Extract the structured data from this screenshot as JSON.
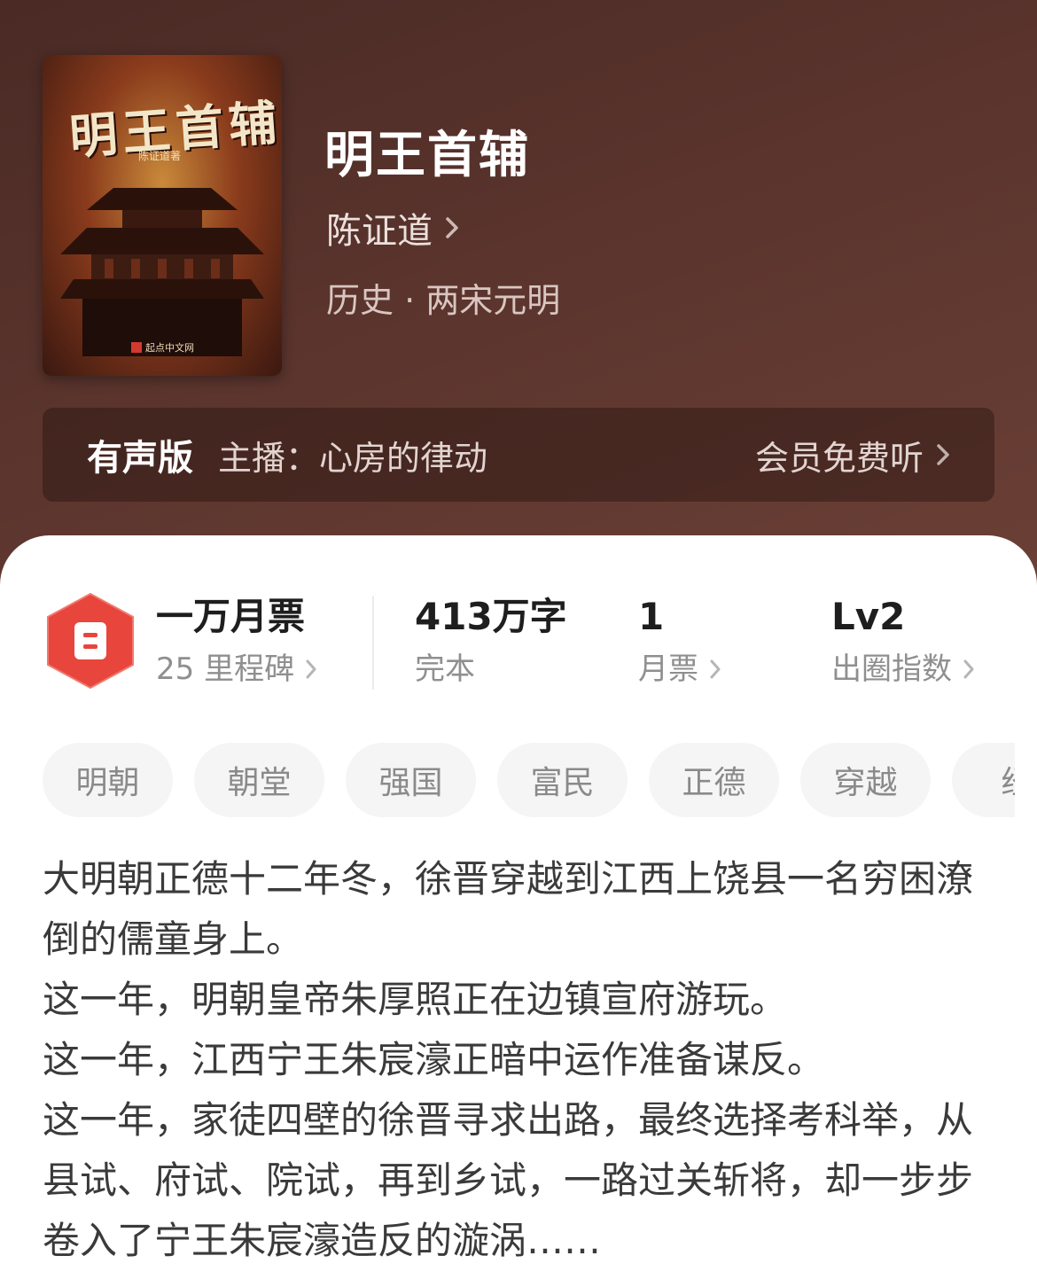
{
  "book": {
    "title": "明王首辅",
    "author": "陈证道",
    "category": "历史 · 两宋元明",
    "cover": {
      "title": "明王首辅",
      "author_line": "陈证道著",
      "publisher": "起点中文网"
    }
  },
  "audio": {
    "label": "有声版",
    "host": "主播：心房的律动",
    "cta": "会员免费听"
  },
  "stats": {
    "ticket_title": "一万月票",
    "milestones": "25 里程碑",
    "word_count": "413万字",
    "status": "完本",
    "monthly_votes": "1",
    "monthly_votes_label": "月票",
    "level": "Lv2",
    "level_label": "出圈指数"
  },
  "tags": [
    "明朝",
    "朝堂",
    "强国",
    "富民",
    "正德",
    "穿越",
    "经"
  ],
  "synopsis": [
    "大明朝正德十二年冬，徐晋穿越到江西上饶县一名穷困潦倒的儒童身上。",
    "这一年，明朝皇帝朱厚照正在边镇宣府游玩。",
    "这一年，江西宁王朱宸濠正暗中运作准备谋反。",
    "这一年，家徒四壁的徐晋寻求出路，最终选择考科举，从县试、府试、院试，再到乡试，一路过关斩将，却一步步卷入了宁王朱宸濠造反的漩涡……"
  ],
  "colors": {
    "header_bg": "#5a342d",
    "badge_red": "#e8453c",
    "tag_bg": "#f5f5f5"
  }
}
